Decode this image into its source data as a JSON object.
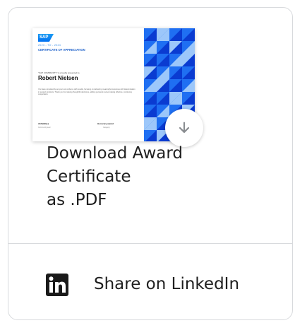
{
  "certificate_preview": {
    "logo_text": "SAP",
    "year_line": "2023 - TO - 2024",
    "title": "CERTIFICATE OF APPRECIATION",
    "presented_to": "\"SAP COMMUNITY\" is proudly presented to",
    "recipient_name": "Robert Nielsen",
    "description": "You have consistently set your own scheme with results, focusing on delivering meaningful outcomes with determination in support products. Thank you for making thoughtful decisions, adding personal review making effective, continuing cooperation.",
    "signature_left": "Ahlfeldt(s)",
    "signature_left_sub": "Community lead",
    "signature_right": "Honorary award",
    "signature_right_sub": "Category"
  },
  "download": {
    "label_lines": [
      "Download Award",
      "Certificate",
      "as .PDF"
    ],
    "icon": "arrow-down-icon"
  },
  "share": {
    "icon": "linkedin-icon",
    "label": "Share on LinkedIn"
  },
  "colors": {
    "border": "#d8dadd",
    "text": "#1f1f1f",
    "pattern_dark": "#0a3bd1",
    "pattern_mid": "#1f6ff2",
    "pattern_light": "#9cc7fa"
  }
}
